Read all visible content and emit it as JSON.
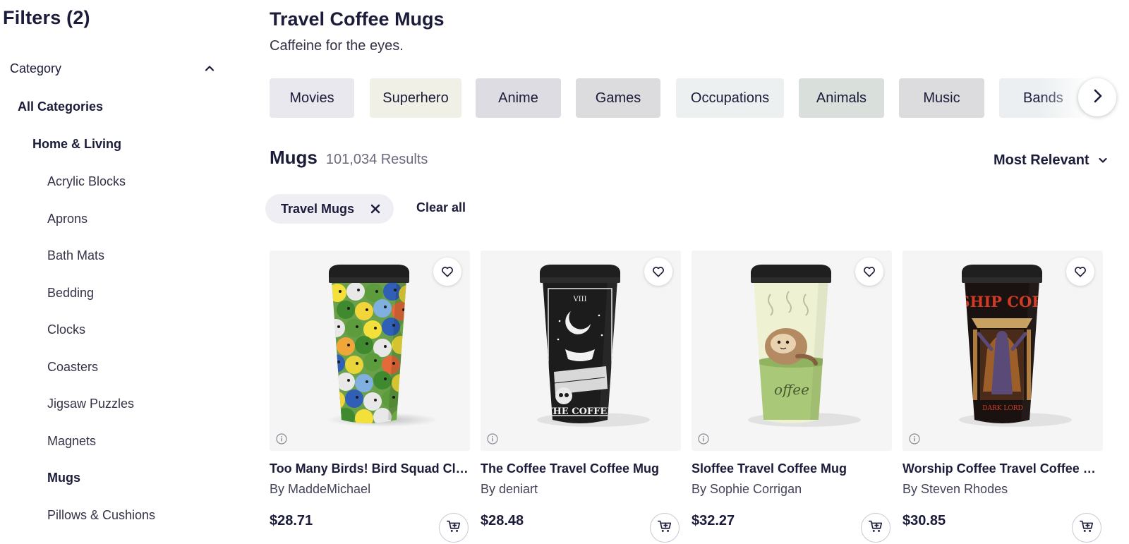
{
  "sidebar": {
    "filters_title": "Filters (2)",
    "category_label": "Category",
    "tree": [
      {
        "label": "All Categories"
      },
      {
        "label": "Home & Living"
      },
      {
        "label": "Acrylic Blocks"
      },
      {
        "label": "Aprons"
      },
      {
        "label": "Bath Mats"
      },
      {
        "label": "Bedding"
      },
      {
        "label": "Clocks"
      },
      {
        "label": "Coasters"
      },
      {
        "label": "Jigsaw Puzzles"
      },
      {
        "label": "Magnets"
      },
      {
        "label": "Mugs"
      },
      {
        "label": "Pillows & Cushions"
      }
    ]
  },
  "header": {
    "title": "Travel Coffee Mugs",
    "subtitle": "Caffeine for the eyes."
  },
  "chips": [
    {
      "label": "Movies",
      "color": "#e8e8ee"
    },
    {
      "label": "Superhero",
      "color": "#f1f0e6"
    },
    {
      "label": "Anime",
      "color": "#dcdce2"
    },
    {
      "label": "Games",
      "color": "#dcdcdf"
    },
    {
      "label": "Occupations",
      "color": "#ecf0f0"
    },
    {
      "label": "Animals",
      "color": "#d9dfdb"
    },
    {
      "label": "Music",
      "color": "#dcdcdf"
    },
    {
      "label": "Bands",
      "color": "#ebeff1"
    }
  ],
  "results": {
    "category": "Mugs",
    "count": "101,034 Results",
    "sort_label": "Most Relevant"
  },
  "active_filter": {
    "label": "Travel Mugs",
    "clear_label": "Clear all"
  },
  "products": [
    {
      "title": "Too Many Birds! Bird Squad Classic Travel Coffee Mug",
      "artist": "By MaddeMichael",
      "price": "$28.71",
      "image": "colorful-birds-travel-mug"
    },
    {
      "title": "The Coffee Travel Coffee Mug",
      "artist": "By deniart",
      "price": "$28.48",
      "image": "tarot-coffee-travel-mug"
    },
    {
      "title": "Sloffee Travel Coffee Mug",
      "artist": "By Sophie Corrigan",
      "price": "$32.27",
      "image": "sloth-coffee-travel-mug"
    },
    {
      "title": "Worship Coffee Travel Coffee Mug",
      "artist": "By Steven Rhodes",
      "price": "$30.85",
      "image": "worship-coffee-travel-mug"
    }
  ],
  "mug_art": {
    "card3_text": "offee",
    "card4_banner": "RSHIP COFF",
    "card4_caption": "DARK LORD",
    "card2_caption": "THE COFFEE",
    "card2_numeral": "VIII"
  },
  "colors": {
    "text": "#1b1b3a",
    "muted": "#6b6b80",
    "card_bg": "#f5f5f5"
  }
}
